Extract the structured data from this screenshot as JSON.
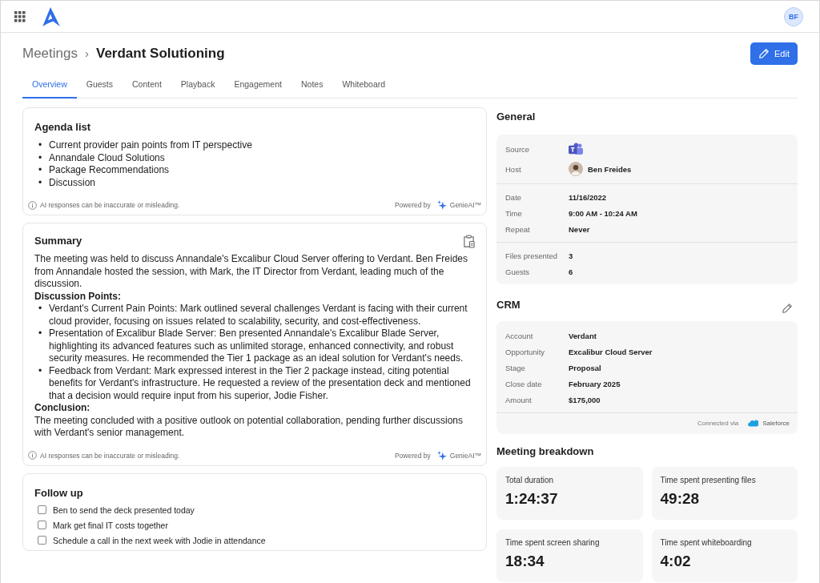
{
  "header": {
    "avatar_initials": "BF"
  },
  "breadcrumb": {
    "parent": "Meetings",
    "separator": "›",
    "title": "Verdant Solutioning"
  },
  "edit_button": "Edit",
  "tabs": [
    {
      "label": "Overview",
      "selected": true
    },
    {
      "label": "Guests",
      "selected": false
    },
    {
      "label": "Content",
      "selected": false
    },
    {
      "label": "Playback",
      "selected": false
    },
    {
      "label": "Engagement",
      "selected": false
    },
    {
      "label": "Notes",
      "selected": false
    },
    {
      "label": "Whiteboard",
      "selected": false
    }
  ],
  "agenda": {
    "title": "Agenda list",
    "bullet": "•",
    "items": [
      "Current provider pain points from IT perspective",
      "Annandale Cloud Solutions",
      "Package Recommendations",
      "Discussion"
    ],
    "disclaimer": "AI responses can be inaccurate or misleading.",
    "powered_by": "Powered by",
    "brand": "GenieAI™"
  },
  "summary": {
    "title": "Summary",
    "bullet": "•",
    "blocks": [
      {
        "kind": "paragraph",
        "text": "The meeting was held to discuss Annandale's Excalibur Cloud Server offering to Verdant. Ben Freides from Annandale hosted the session, with Mark, the IT Director from Verdant, leading much of the discussion."
      },
      {
        "kind": "heading",
        "text": "Discussion Points:"
      },
      {
        "kind": "bullets",
        "items": [
          "Verdant's Current Pain Points: Mark outlined several challenges Verdant is facing with their current cloud provider, focusing on issues related to scalability, security, and cost-effectiveness.",
          "Presentation of Excalibur Blade Server: Ben presented Annandale's Excalibur Blade Server, highlighting its advanced features such as unlimited storage, enhanced connectivity, and robust security measures. He recommended the Tier 1 package as an ideal solution for Verdant's needs.",
          "Feedback from Verdant: Mark expressed interest in the Tier 2 package instead, citing potential benefits for Verdant's infrastructure. He requested a review of the presentation deck and mentioned that a decision would require input from his superior, Jodie Fisher."
        ]
      },
      {
        "kind": "heading",
        "text": "Conclusion:"
      },
      {
        "kind": "paragraph",
        "text": "The meeting concluded with a positive outlook on potential collaboration, pending further discussions with Verdant's senior management."
      }
    ],
    "disclaimer": "AI responses can be inaccurate or misleading.",
    "powered_by": "Powered by",
    "brand": "GenieAI™"
  },
  "follow_up": {
    "title": "Follow up",
    "items": [
      {
        "text": "Ben to send the deck presented today",
        "checked": false
      },
      {
        "text": "Mark get final IT costs together",
        "checked": false
      },
      {
        "text": "Schedule a call in the next week with Jodie in attendance",
        "checked": false
      }
    ]
  },
  "general": {
    "title": "General",
    "groups": [
      [
        {
          "label": "Source",
          "kind": "app"
        },
        {
          "label": "Host",
          "kind": "person",
          "value": "Ben Freides"
        }
      ],
      [
        {
          "label": "Date",
          "kind": "text",
          "value": "11/16/2022"
        },
        {
          "label": "Time",
          "kind": "text",
          "value": "9:00 AM - 10:24 AM"
        },
        {
          "label": "Repeat",
          "kind": "text",
          "value": "Never"
        }
      ],
      [
        {
          "label": "Files presented",
          "kind": "text",
          "value": "3"
        },
        {
          "label": "Guests",
          "kind": "text",
          "value": "6"
        }
      ]
    ]
  },
  "crm": {
    "title": "CRM",
    "fields": [
      {
        "label": "Account",
        "value": "Verdant"
      },
      {
        "label": "Opportunity",
        "value": "Excalibur Cloud Server"
      },
      {
        "label": "Stage",
        "value": "Proposal"
      },
      {
        "label": "Close date",
        "value": "February 2025"
      },
      {
        "label": "Amount",
        "value": "$175,000"
      }
    ],
    "connected_label": "Connected via",
    "connected_brand": "Saleforce"
  },
  "breakdown": {
    "title": "Meeting breakdown",
    "stats": [
      {
        "label": "Total duration",
        "value": "1:24:37"
      },
      {
        "label": "Time spent presenting files",
        "value": "49:28"
      },
      {
        "label": "Time spent screen sharing",
        "value": "18:34"
      },
      {
        "label": "Time spent whiteboarding",
        "value": "4:02"
      }
    ]
  }
}
